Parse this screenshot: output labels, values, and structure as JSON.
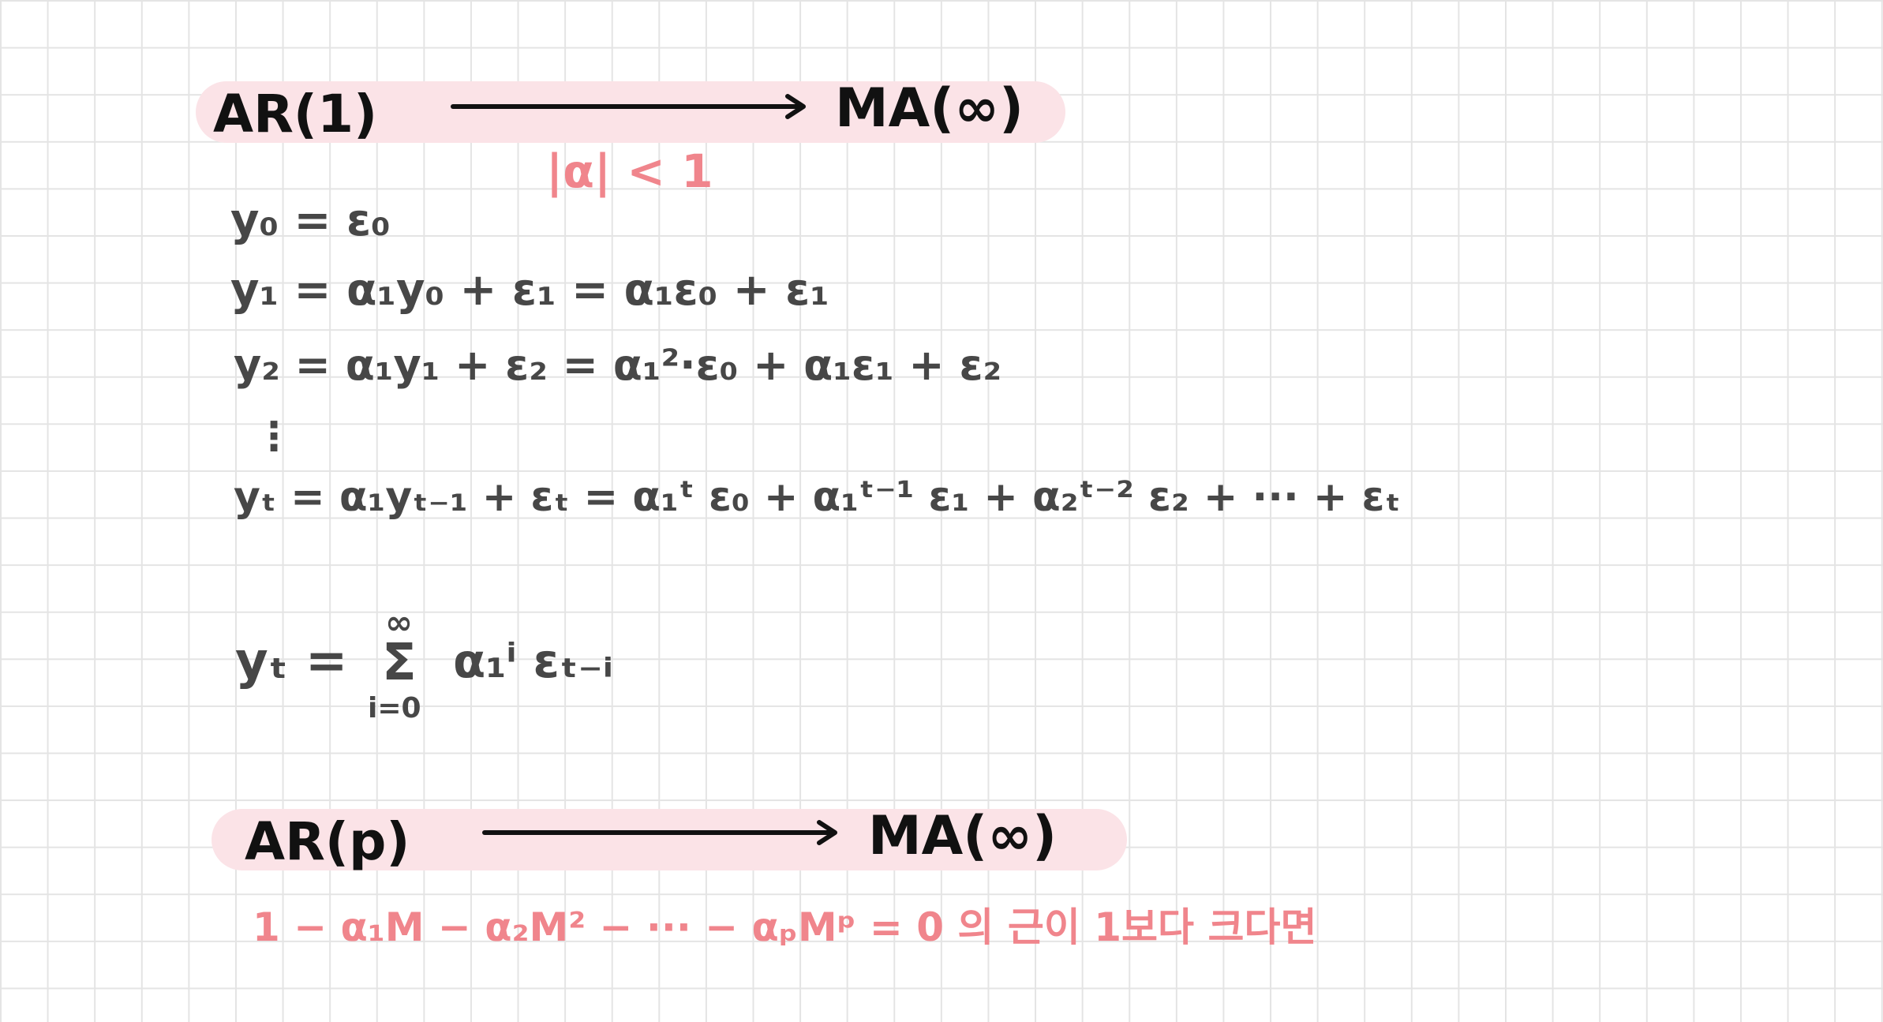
{
  "section1": {
    "from": "AR(1)",
    "to": "MA(∞)",
    "condition": "|α| < 1"
  },
  "lines": [
    "y₀ = ε₀",
    "y₁ = α₁y₀ + ε₁ = α₁ε₀ + ε₁",
    "y₂ = α₁y₁ + ε₂ = α₁²·ε₀ + α₁ε₁ + ε₂",
    "⋮",
    "yₜ = α₁yₜ₋₁ + εₜ = α₁ᵗ ε₀ + α₁ᵗ⁻¹ ε₁ + α₂ᵗ⁻² ε₂ + ··· + εₜ"
  ],
  "sum_formula": {
    "lhs": "yₜ =",
    "sigma": "Σ",
    "upper": "∞",
    "lower": "i=0",
    "term": "α₁ⁱ εₜ₋ᵢ"
  },
  "section2": {
    "from": "AR(p)",
    "to": "MA(∞)",
    "condition": "1 − α₁M − α₂M² − ··· − αₚMᵖ = 0 의 근이 1보다 크다면"
  },
  "colors": {
    "grid": "#e4e4e4",
    "highlight": "#fbe3e7",
    "ink": "#474747",
    "arrow_ink": "#111111",
    "accent": "#f0858c"
  }
}
